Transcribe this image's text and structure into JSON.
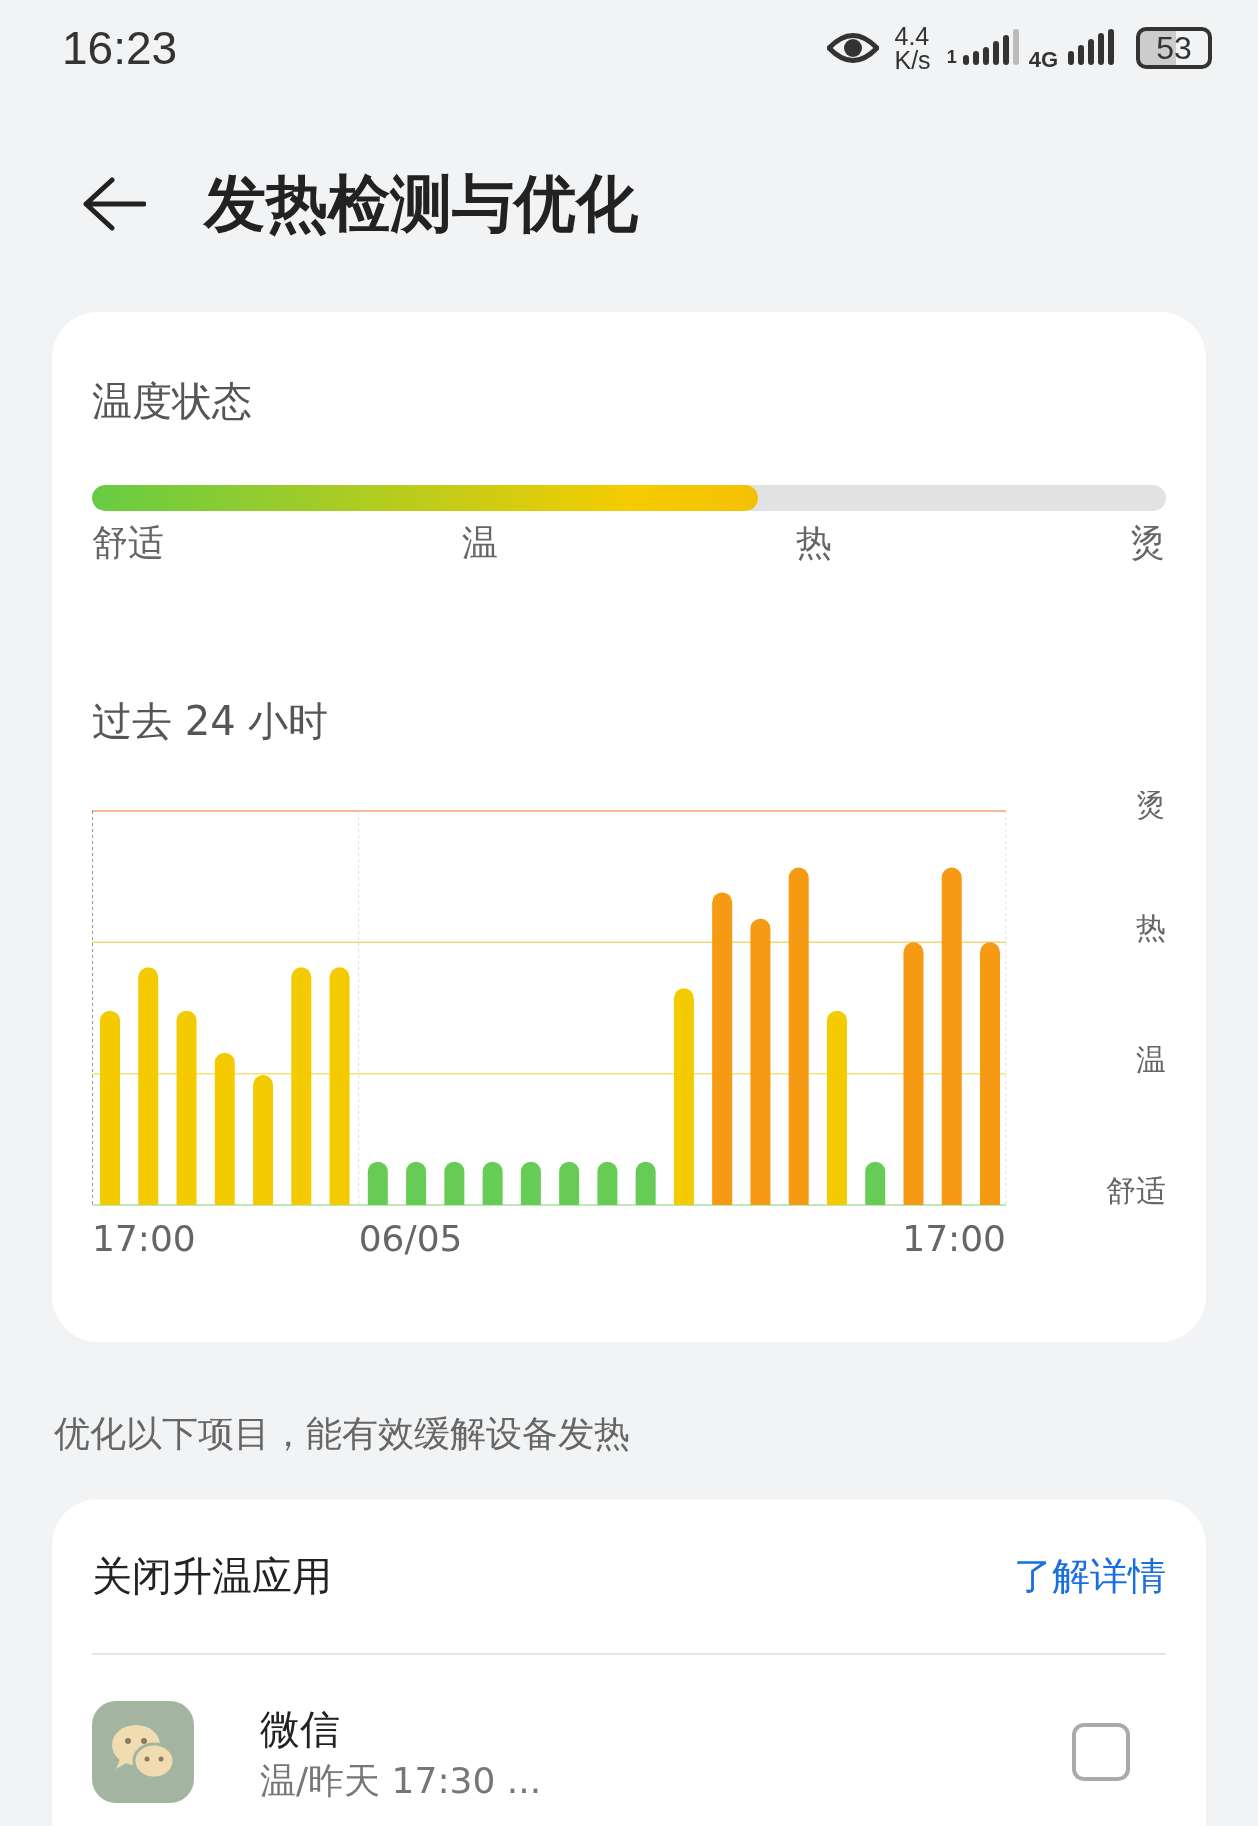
{
  "status_bar": {
    "time": "16:23",
    "speed_value": "4.4",
    "speed_unit": "K/s",
    "sim_number": "1",
    "network": "4G",
    "battery": "53"
  },
  "header": {
    "title": "发热检测与优化"
  },
  "temperature_card": {
    "title": "温度状态",
    "level": 0.62,
    "scale_labels": [
      "舒适",
      "温",
      "热",
      "烫"
    ],
    "history_title": "过去 24 小时",
    "history_chart": {
      "level_labels": [
        "烫",
        "热",
        "温",
        "舒适"
      ],
      "time_labels": [
        "17:00",
        "06/05",
        "17:00"
      ]
    }
  },
  "hint": "优化以下项目，能有效缓解设备发热",
  "apps_card": {
    "title": "关闭升温应用",
    "link": "了解详情",
    "apps": [
      {
        "name": "微信",
        "detail": "温/昨天 17:30 ...",
        "checked": false
      }
    ]
  }
}
